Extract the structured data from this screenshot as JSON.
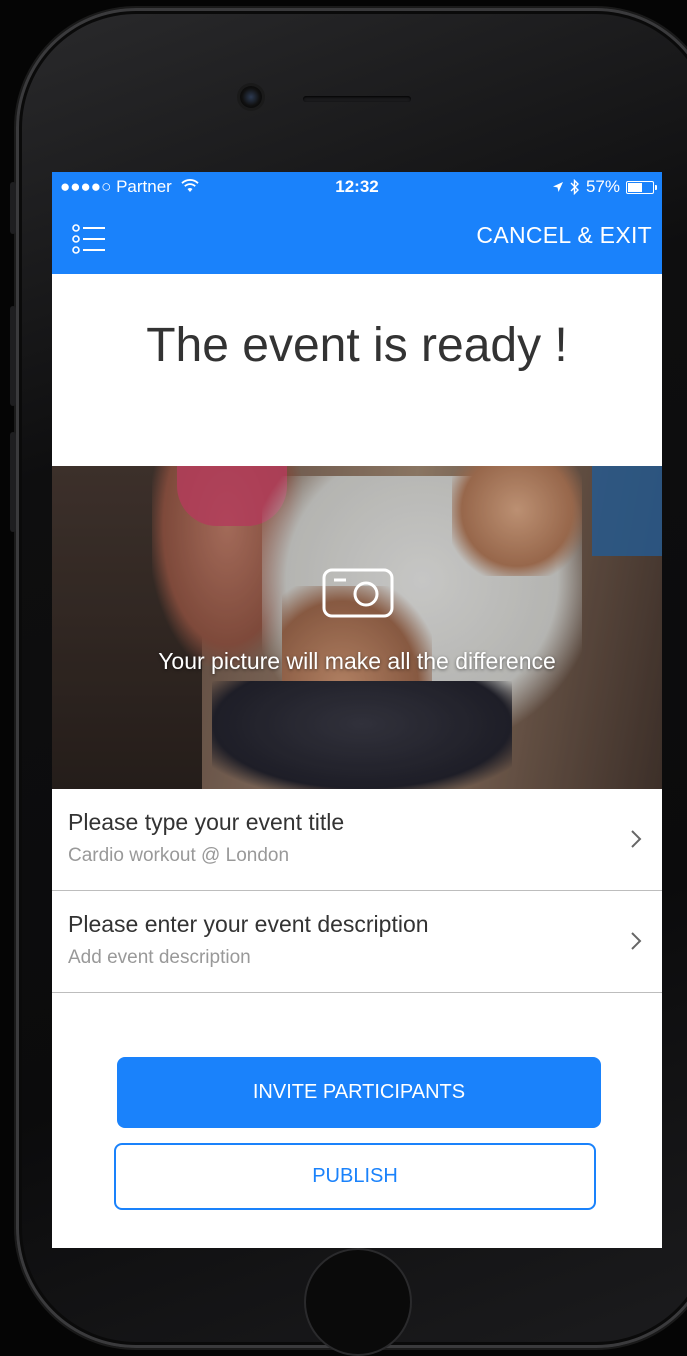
{
  "status_bar": {
    "carrier": "●●●●○ Partner",
    "wifi_icon": "wifi-icon",
    "time": "12:32",
    "location_icon": "location-arrow-icon",
    "bluetooth_icon": "bluetooth-icon",
    "battery": "57%"
  },
  "nav_bar": {
    "menu_icon": "list-menu-icon",
    "cancel_label": "CANCEL & EXIT"
  },
  "page_title": "The event is ready !",
  "cover_photo": {
    "camera_icon": "camera-icon",
    "caption": "Your picture will make all the difference"
  },
  "fields": [
    {
      "label": "Please type your event title",
      "value": "Cardio workout @ London"
    },
    {
      "label": "Please enter your event description",
      "value": "Add event description"
    }
  ],
  "actions": {
    "invite_label": "INVITE PARTICIPANTS",
    "publish_label": "PUBLISH"
  },
  "colors": {
    "accent": "#1a82fb",
    "text": "#333333",
    "placeholder": "#999999"
  }
}
